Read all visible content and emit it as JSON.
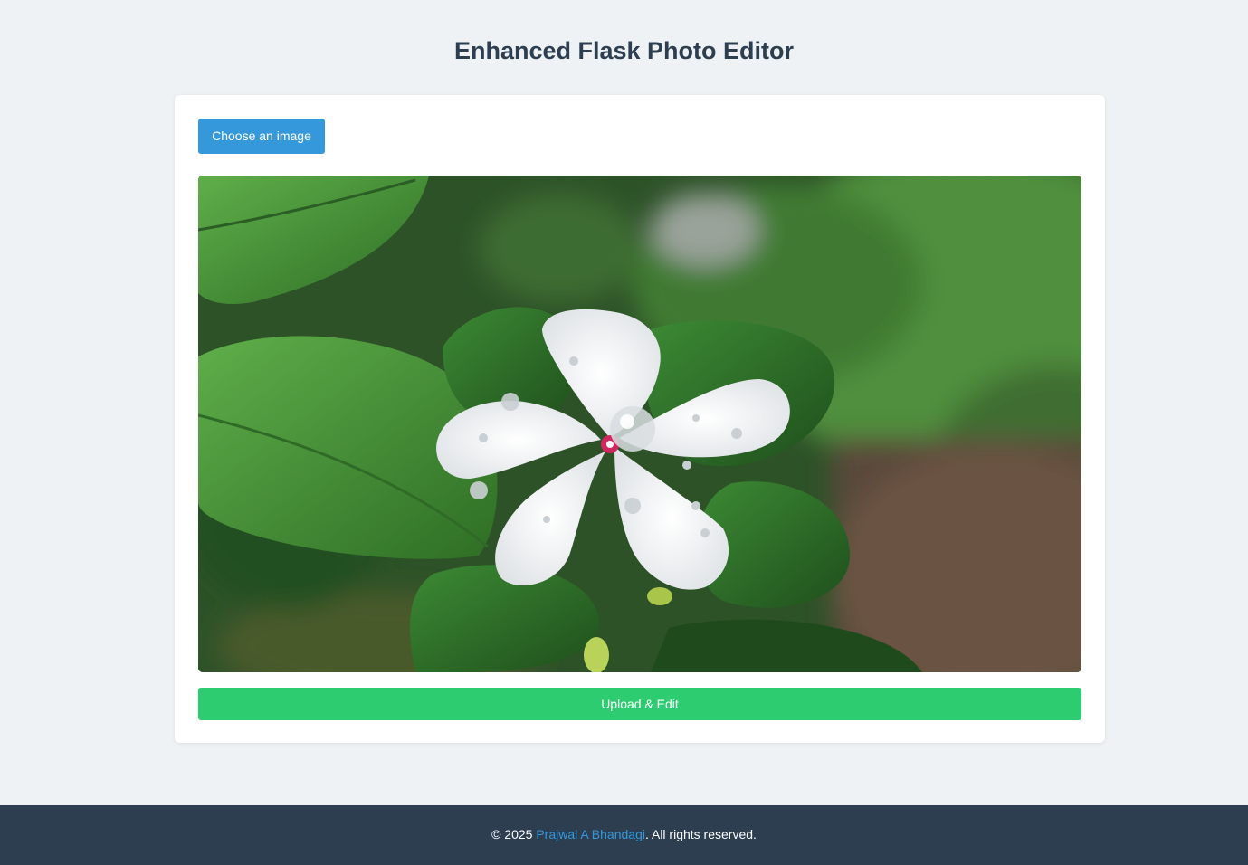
{
  "header": {
    "title": "Enhanced Flask Photo Editor"
  },
  "form": {
    "choose_label": "Choose an image",
    "upload_label": "Upload & Edit"
  },
  "preview": {
    "subject": "white-periwinkle-flower-with-water-drops"
  },
  "footer": {
    "copyright_prefix": "© 2025 ",
    "author": "Prajwal A Bhandagi",
    "copyright_suffix": ". All rights reserved."
  },
  "colors": {
    "background": "#eef2f5",
    "title": "#2c3e50",
    "choose_button": "#3498db",
    "upload_button": "#2ecc71",
    "footer_bg": "#2c3e50",
    "link": "#3498db"
  }
}
